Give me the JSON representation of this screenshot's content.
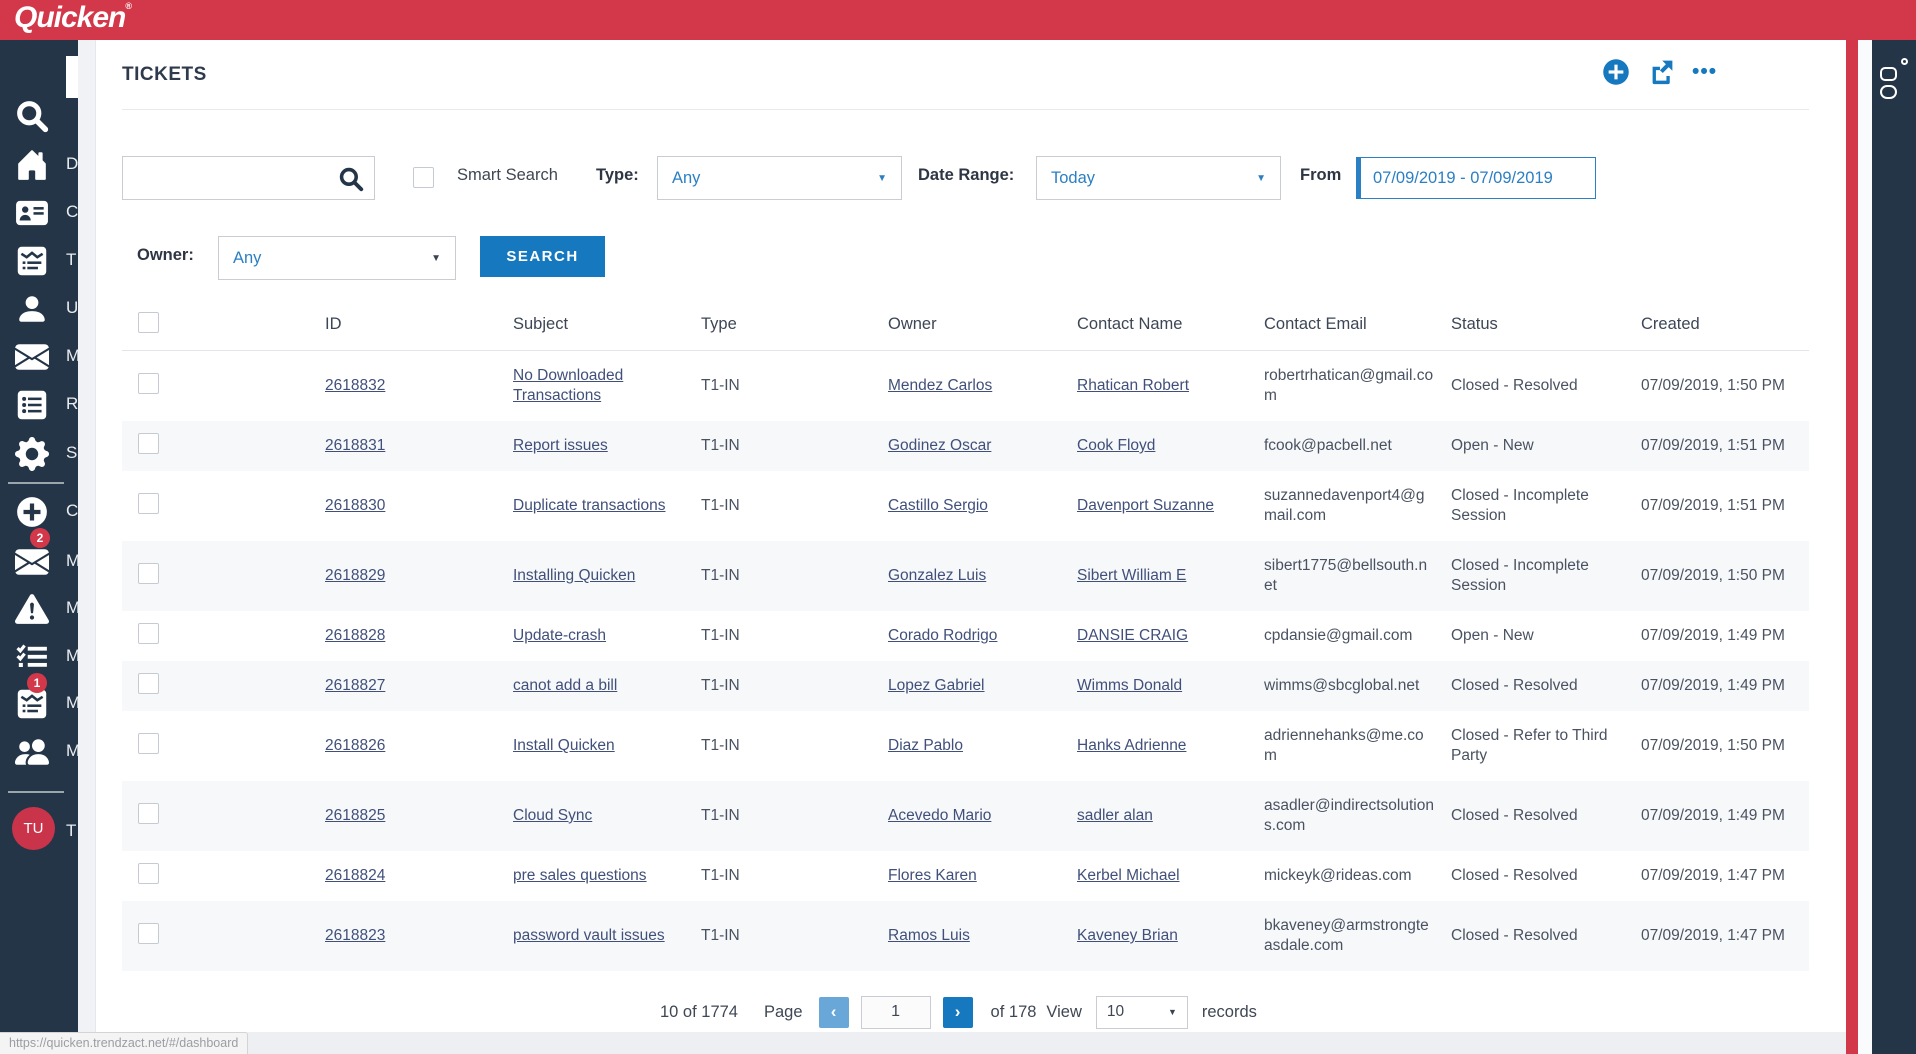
{
  "colors": {
    "brand_red": "#d2384a",
    "sidebar_navy": "#243548",
    "accent_blue": "#1678be",
    "link_blue": "#2b7fc3",
    "table_link": "#41507a"
  },
  "topbar": {
    "logo": "Quicken",
    "trademark": "®"
  },
  "sidebar": {
    "items": [
      {
        "icon": "search-icon",
        "partial_label": ""
      },
      {
        "icon": "home-icon",
        "partial_label": "D"
      },
      {
        "icon": "contact-card-icon",
        "partial_label": "C"
      },
      {
        "icon": "ticket-card-icon",
        "partial_label": "T"
      },
      {
        "icon": "user-icon",
        "partial_label": "U"
      },
      {
        "icon": "mail-icon",
        "partial_label": "M"
      },
      {
        "icon": "report-list-icon",
        "partial_label": "R"
      },
      {
        "icon": "gear-icon",
        "partial_label": "S"
      },
      {
        "icon": "plus-circle-icon",
        "partial_label": "C"
      },
      {
        "icon": "mail-icon",
        "partial_label": "M",
        "badge": "2"
      },
      {
        "icon": "warning-icon",
        "partial_label": "M"
      },
      {
        "icon": "checklist-icon",
        "partial_label": "M"
      },
      {
        "icon": "ticket-card-icon",
        "partial_label": "M",
        "badge": "1"
      },
      {
        "icon": "people-icon",
        "partial_label": "M"
      }
    ],
    "avatar": {
      "initials": "TU",
      "partial_label": "T"
    }
  },
  "page": {
    "title": "TICKETS",
    "actions": [
      {
        "icon": "add-circle-icon"
      },
      {
        "icon": "share-icon"
      },
      {
        "icon": "more-ellipsis-icon"
      }
    ]
  },
  "filters": {
    "search_placeholder": "",
    "smart_search_label": "Smart Search",
    "type_label": "Type:",
    "type_value": "Any",
    "date_range_label": "Date Range:",
    "date_range_value": "Today",
    "from_label": "From",
    "from_value": "07/09/2019 - 07/09/2019",
    "owner_label": "Owner:",
    "owner_value": "Any",
    "search_button": "SEARCH"
  },
  "table": {
    "columns": [
      "ID",
      "Subject",
      "Type",
      "Owner",
      "Contact Name",
      "Contact Email",
      "Status",
      "Created"
    ],
    "rows": [
      {
        "id": "2618832",
        "subject": "No Downloaded Transactions",
        "type": "T1-IN",
        "owner": "Mendez Carlos",
        "contact": "Rhatican Robert",
        "email": "robertrhatican@gmail.com",
        "status": "Closed - Resolved",
        "created": "07/09/2019, 1:50 PM"
      },
      {
        "id": "2618831",
        "subject": "Report issues",
        "type": "T1-IN",
        "owner": "Godinez Oscar",
        "contact": "Cook Floyd",
        "email": "fcook@pacbell.net",
        "status": "Open - New",
        "created": "07/09/2019, 1:51 PM"
      },
      {
        "id": "2618830",
        "subject": "Duplicate transactions",
        "type": "T1-IN",
        "owner": "Castillo Sergio",
        "contact": "Davenport Suzanne",
        "email": "suzannedavenport4@gmail.com",
        "status": "Closed - Incomplete Session",
        "created": "07/09/2019, 1:51 PM"
      },
      {
        "id": "2618829",
        "subject": "Installing Quicken",
        "type": "T1-IN",
        "owner": "Gonzalez Luis",
        "contact": "Sibert William E",
        "email": "sibert1775@bellsouth.net",
        "status": "Closed - Incomplete Session",
        "created": "07/09/2019, 1:50 PM"
      },
      {
        "id": "2618828",
        "subject": "Update-crash",
        "type": "T1-IN",
        "owner": "Corado Rodrigo",
        "contact": "DANSIE CRAIG",
        "email": "cpdansie@gmail.com",
        "status": "Open - New",
        "created": "07/09/2019, 1:49 PM"
      },
      {
        "id": "2618827",
        "subject": "canot add a bill",
        "type": "T1-IN",
        "owner": "Lopez Gabriel",
        "contact": "Wimms Donald",
        "email": "wimms@sbcglobal.net",
        "status": "Closed - Resolved",
        "created": "07/09/2019, 1:49 PM"
      },
      {
        "id": "2618826",
        "subject": "Install Quicken",
        "type": "T1-IN",
        "owner": "Diaz Pablo",
        "contact": "Hanks Adrienne",
        "email": "adriennehanks@me.com",
        "status": "Closed - Refer to Third Party",
        "created": "07/09/2019, 1:50 PM"
      },
      {
        "id": "2618825",
        "subject": "Cloud Sync",
        "type": "T1-IN",
        "owner": "Acevedo Mario",
        "contact": "sadler alan",
        "email": "asadler@indirectsolutions.com",
        "status": "Closed - Resolved",
        "created": "07/09/2019, 1:49 PM"
      },
      {
        "id": "2618824",
        "subject": "pre sales questions",
        "type": "T1-IN",
        "owner": "Flores Karen",
        "contact": "Kerbel Michael",
        "email": "mickeyk@rideas.com",
        "status": "Closed - Resolved",
        "created": "07/09/2019, 1:47 PM"
      },
      {
        "id": "2618823",
        "subject": "password vault issues",
        "type": "T1-IN",
        "owner": "Ramos Luis",
        "contact": "Kaveney Brian",
        "email": "bkaveney@armstrongteasdale.com",
        "status": "Closed - Resolved",
        "created": "07/09/2019, 1:47 PM"
      }
    ]
  },
  "pagination": {
    "count": "10 of 1774",
    "page_label": "Page",
    "prev": "‹",
    "page_value": "1",
    "next": "›",
    "of_label": "of 178",
    "view_label": "View",
    "view_value": "10",
    "records_label": "records"
  },
  "right_rail": {
    "icon": "vertical-widget-icon"
  },
  "statusbar": {
    "url": "https://quicken.trendzact.net/#/dashboard"
  }
}
